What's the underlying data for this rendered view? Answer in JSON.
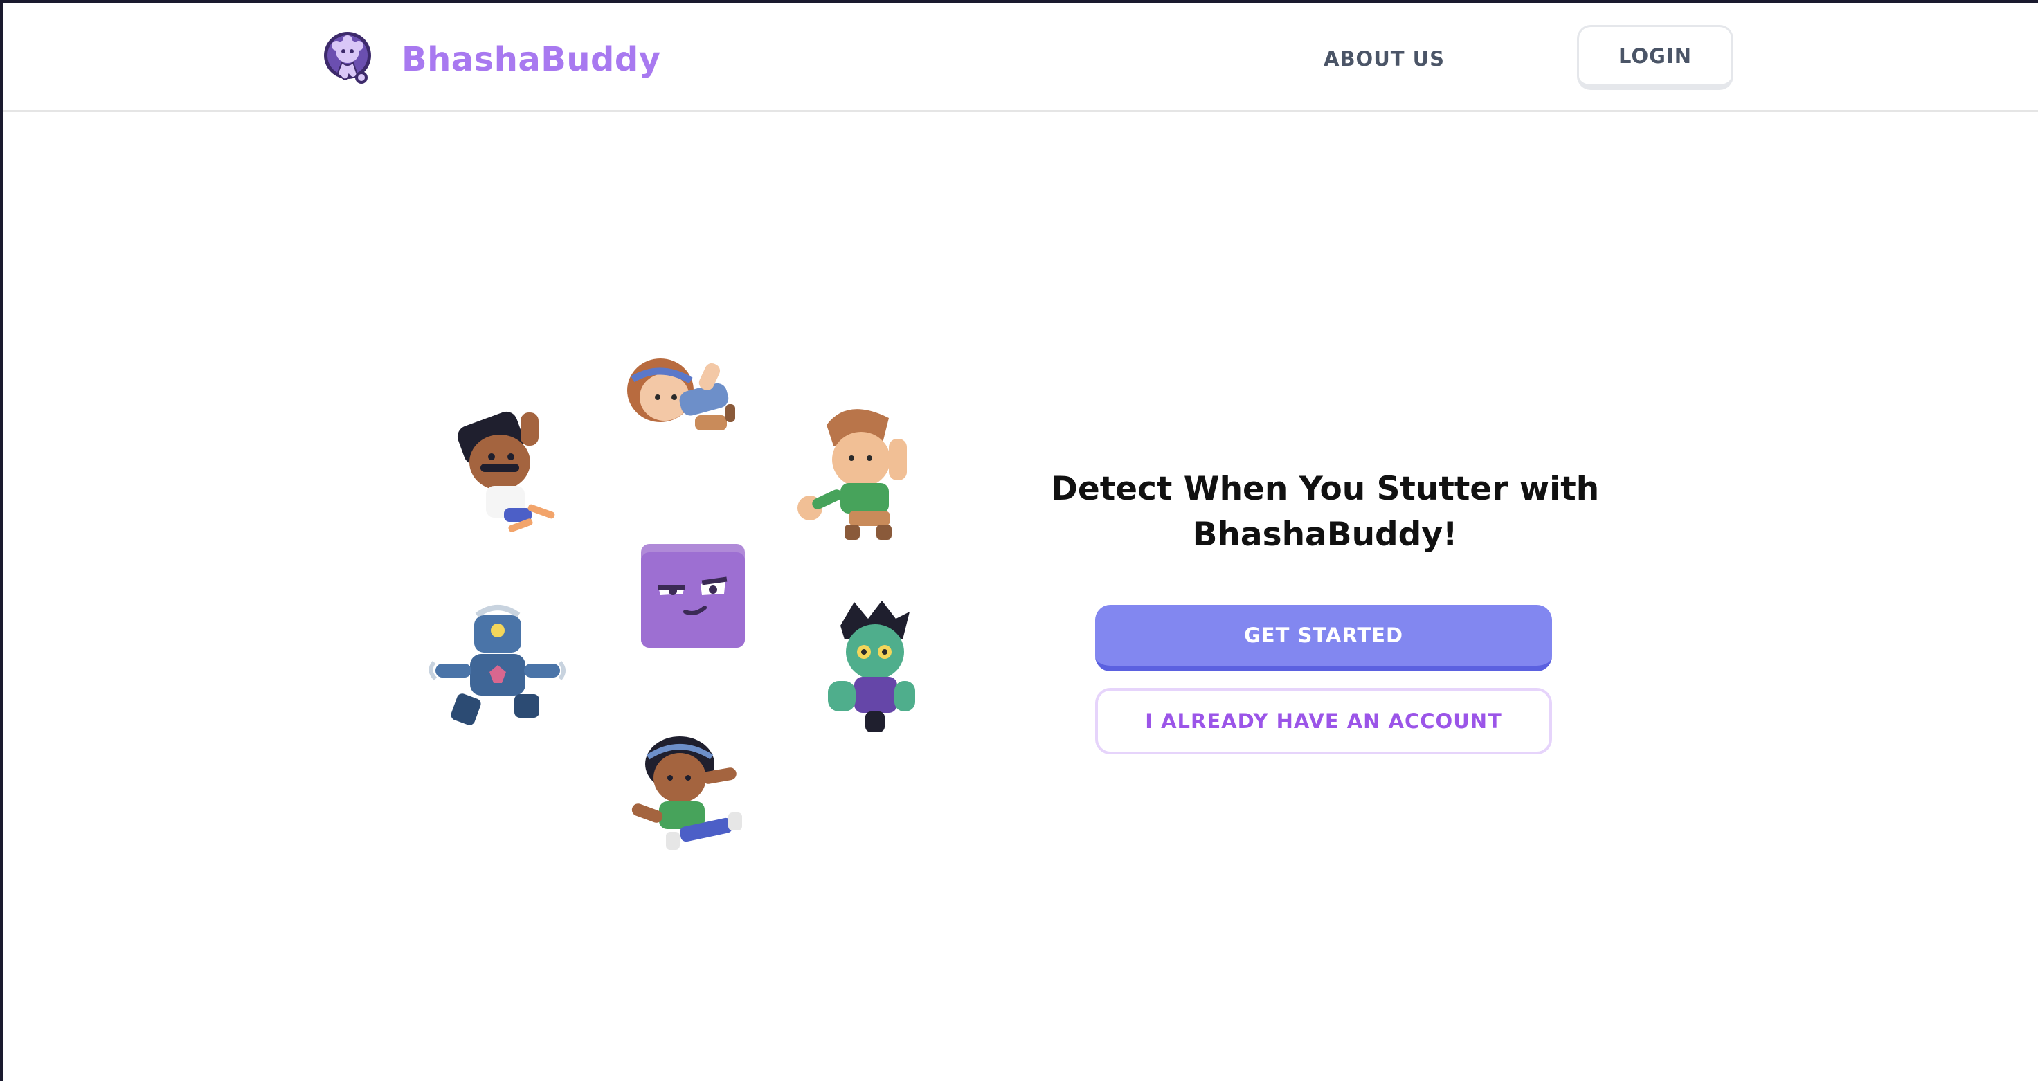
{
  "header": {
    "brand_name": "BhashaBuddy",
    "logo_icon": "octopus-logo-icon",
    "nav": {
      "about_label": "ABOUT US",
      "login_label": "LOGIN"
    }
  },
  "hero": {
    "headline": "Detect When You Stutter with BhashaBuddy!",
    "get_started_label": "GET STARTED",
    "existing_account_label": "I ALREADY HAVE AN ACCOUNT"
  },
  "illustration": {
    "characters": [
      "mustache-man-character",
      "girl-headband-character",
      "boy-green-shirt-character",
      "purple-block-character",
      "robot-character",
      "zombie-character",
      "girl-green-shirt-character"
    ]
  },
  "colors": {
    "brand": "#a879f0",
    "primary_button": "#8287f0",
    "primary_button_shadow": "#5b61e0",
    "secondary_text": "#9b55e8",
    "nav_text": "#4b5567"
  }
}
